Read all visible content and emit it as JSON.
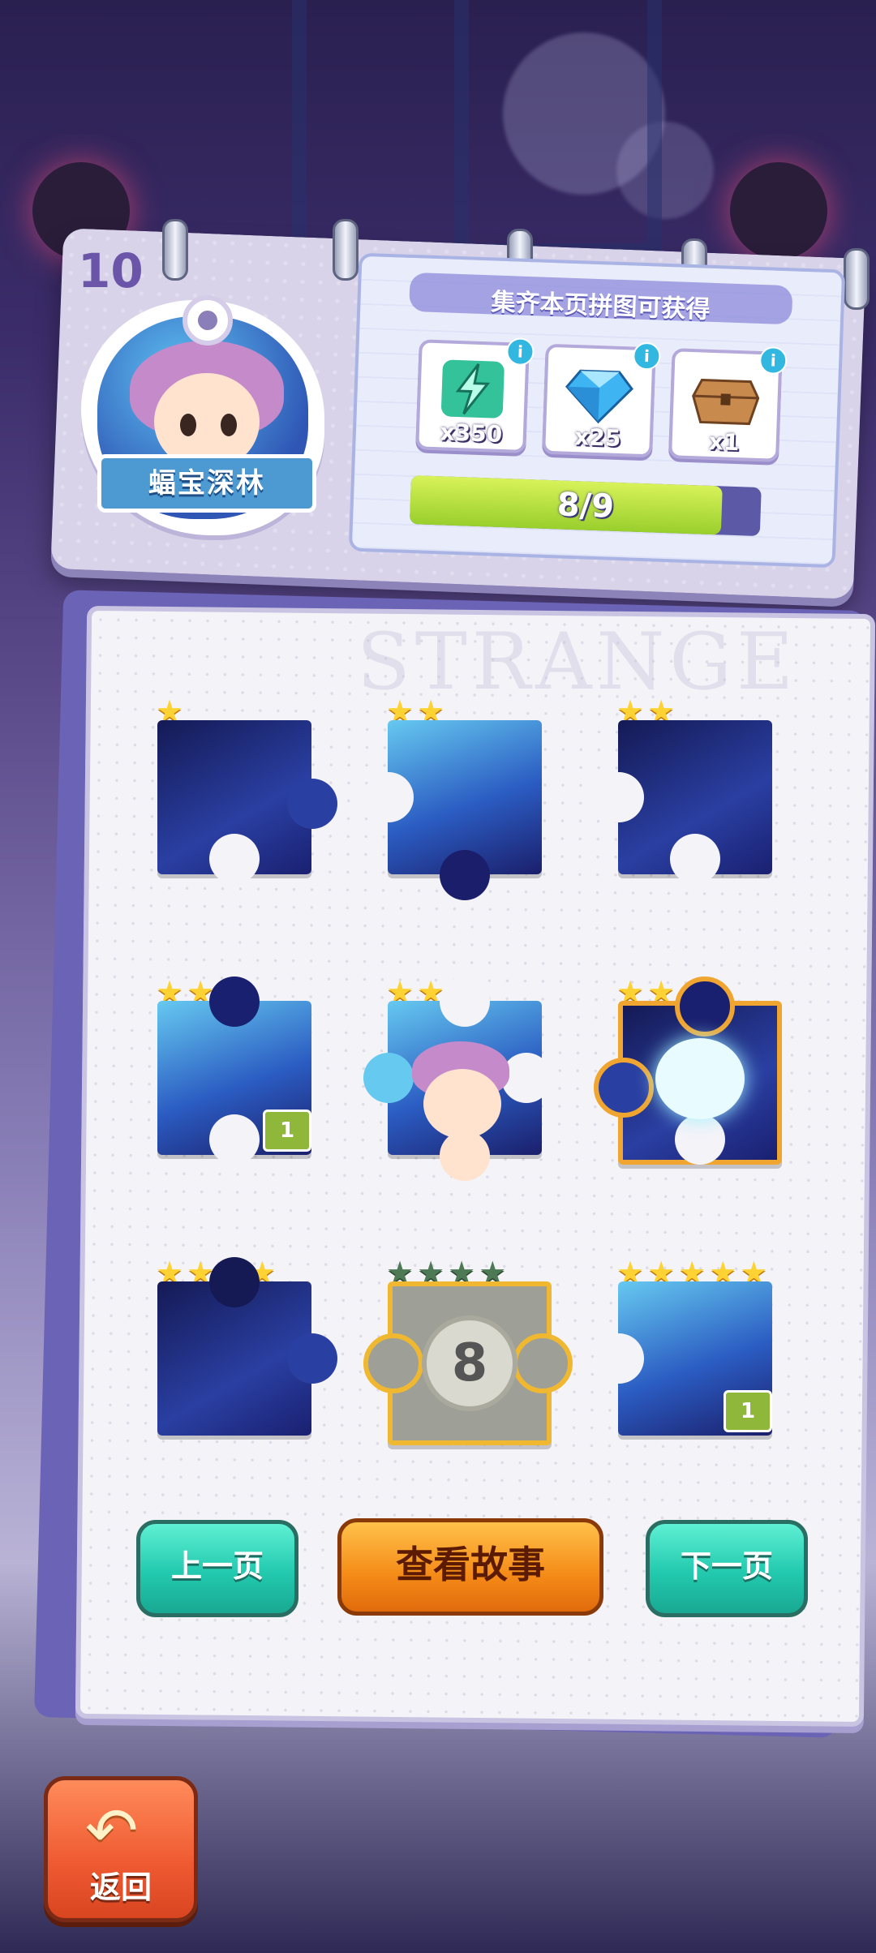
{
  "header": {
    "page_number": "10",
    "character_name": "蝠宝深林"
  },
  "reward_panel": {
    "title": "集齐本页拼图可获得",
    "rewards": [
      {
        "icon": "energy-bolt-icon",
        "count": "x350",
        "info": "i"
      },
      {
        "icon": "diamond-icon",
        "count": "x25",
        "info": "i"
      },
      {
        "icon": "treasure-chest-icon",
        "count": "x1",
        "info": "i"
      }
    ],
    "progress_text": "8/9",
    "progress_fraction": 0.889
  },
  "book": {
    "watermark": "STRANGE"
  },
  "pieces": [
    {
      "stars": 1,
      "badge": null,
      "state": "collected"
    },
    {
      "stars": 2,
      "badge": null,
      "state": "collected"
    },
    {
      "stars": 2,
      "badge": null,
      "state": "collected"
    },
    {
      "stars": 3,
      "badge": "1",
      "state": "collected"
    },
    {
      "stars": 3,
      "badge": null,
      "state": "collected"
    },
    {
      "stars": 3,
      "badge": null,
      "state": "collected-highlight"
    },
    {
      "stars": 4,
      "badge": null,
      "state": "collected"
    },
    {
      "stars": 4,
      "badge": null,
      "state": "locked",
      "lock_label": "8"
    },
    {
      "stars": 5,
      "badge": "1",
      "state": "collected"
    }
  ],
  "buttons": {
    "prev_page": "上一页",
    "view_story": "查看故事",
    "next_page": "下一页",
    "back": "返回"
  },
  "colors": {
    "accent_teal": "#22c9ae",
    "accent_orange": "#f48a17",
    "progress_green": "#99cf2c",
    "star_gold": "#ffd233"
  }
}
